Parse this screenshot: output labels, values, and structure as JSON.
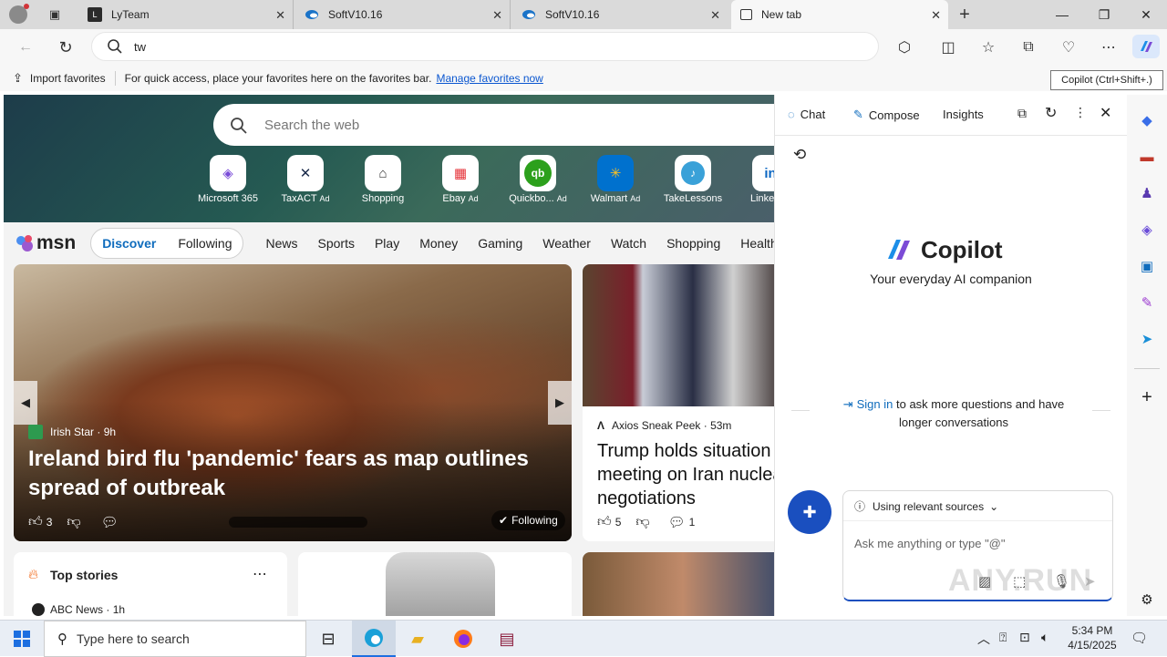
{
  "tabs": [
    {
      "title": "LyTeam",
      "active": false
    },
    {
      "title": "SoftV10.16",
      "active": false
    },
    {
      "title": "SoftV10.16",
      "active": false
    },
    {
      "title": "New tab",
      "active": true
    }
  ],
  "address": {
    "value": "tw"
  },
  "tooltip": "Copilot (Ctrl+Shift+.)",
  "favorites": {
    "import_label": "Import favorites",
    "message": "For quick access, place your favorites here on the favorites bar.",
    "manage_link": "Manage favorites now"
  },
  "newtab": {
    "search_placeholder": "Search the web",
    "quicklinks": [
      {
        "label": "Microsoft 365",
        "ad": false,
        "icon": "microsoft365-icon"
      },
      {
        "label": "TaxACT",
        "ad": true,
        "icon": "taxact-icon"
      },
      {
        "label": "Shopping",
        "ad": false,
        "icon": "shopping-tag-icon"
      },
      {
        "label": "Ebay",
        "ad": true,
        "icon": "ebay-icon"
      },
      {
        "label": "Quickbo...",
        "ad": true,
        "icon": "quickbooks-icon"
      },
      {
        "label": "Walmart",
        "ad": true,
        "icon": "walmart-icon"
      },
      {
        "label": "TakeLessons",
        "ad": false,
        "icon": "takelessons-icon"
      },
      {
        "label": "Linke",
        "ad": false,
        "icon": "linkedin-icon"
      }
    ],
    "ad_label": "Ad",
    "msn_logo": "msn",
    "discover": "Discover",
    "following": "Following",
    "nav": [
      "News",
      "Sports",
      "Play",
      "Money",
      "Gaming",
      "Weather",
      "Watch",
      "Shopping",
      "Health"
    ],
    "hero_card": {
      "source": "Irish Star",
      "age": "9h",
      "headline": "Ireland bird flu 'pandemic' fears as map outlines spread of outbreak",
      "likes": "3",
      "following_label": "Following"
    },
    "side_card": {
      "source": "Axios Sneak Peek",
      "age": "53m",
      "headline": "Trump holds situation meeting on Iran nuclear negotiations",
      "likes": "5",
      "comments": "1"
    },
    "top_stories": {
      "title": "Top stories",
      "source": "ABC News",
      "age": "1h"
    }
  },
  "copilot": {
    "tabs": [
      "Chat",
      "Compose",
      "Insights"
    ],
    "brand": "Copilot",
    "tagline": "Your everyday AI companion",
    "signin_link": "Sign in",
    "signin_text": "to ask more questions and have longer conversations",
    "sources_label": "Using relevant sources",
    "input_placeholder": "Ask me anything or type \"@\""
  },
  "taskbar": {
    "search_placeholder": "Type here to search",
    "time": "5:34 PM",
    "date": "4/15/2025"
  },
  "watermark": "ANY.RUN"
}
